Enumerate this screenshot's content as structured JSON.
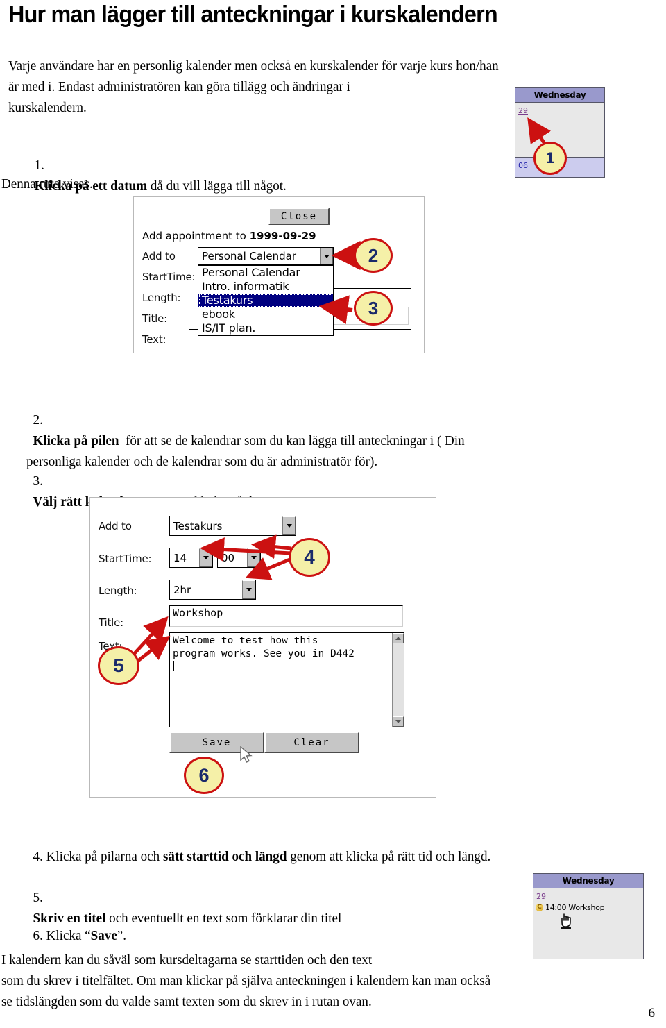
{
  "document": {
    "title": "Hur man lägger till anteckningar i kurskalendern",
    "page_number": "6"
  },
  "paragraphs": {
    "intro": "Varje användare har en personlig kalender men också en kurskalender för varje kurs hon/han\när med i. Endast administratören kan göra tillägg och ändringar i\nkurskalendern.",
    "step1_num": "1.",
    "step1_bold": "Klicka på ett datum",
    "step1_rest": " då du vill lägga till något.",
    "caption_dialog": "Denna ruta visas.",
    "step2_num": "2.",
    "step2_bold": "Klicka på pilen",
    "step2_rest": "  för att se de kalendrar som du kan lägga till anteckningar i ( Din\npersonliga kalender och de kalendrar som du är administratör för).",
    "step3_num": "3.",
    "step3_bold": "Välj rätt kalender",
    "step3_rest": " genom att klicka på den.",
    "step4_num": "4.",
    "step4_pre": " Klicka på pilarna och ",
    "step4_bold": "sätt starttid och längd",
    "step4_rest": " genom att klicka på rätt tid och längd.",
    "step5_num": "5.",
    "step5_bold": "Skriv en titel",
    "step5_rest": " och eventuellt en text som förklarar din titel",
    "step6_num": "6.",
    "step6_pre": " Klicka “",
    "step6_bold": "Save",
    "step6_rest": "”.",
    "outro": "I kalendern kan du såväl som kursdeltagarna se starttiden och den text\nsom du skrev i titelfältet. Om man klickar på själva anteckningen i kalendern kan man också\nse tidslängden som du valde samt texten som du skrev in i rutan ovan."
  },
  "calendar_top": {
    "day_header": "Wednesday",
    "date_link": "29",
    "next_date_link": "06",
    "callout": "1"
  },
  "calendar_bottom": {
    "day_header": "Wednesday",
    "date_link": "29",
    "event_bullet": "C",
    "event_label": "14:00 Workshop"
  },
  "dialog_dropdown": {
    "close_button": "Close",
    "heading_prefix": "Add appointment to ",
    "heading_date": "1999-09-29",
    "labels": {
      "add_to": "Add to",
      "start_time": "StartTime:",
      "length": "Length:",
      "title": "Title:",
      "text": "Text:"
    },
    "selected_value": "Personal Calendar",
    "options": [
      "Personal Calendar",
      "Intro. informatik",
      "Testakurs",
      "ebook",
      "IS/IT plan."
    ],
    "selected_index": 2,
    "callouts": {
      "arrow": "2",
      "option": "3"
    }
  },
  "dialog_filled": {
    "labels": {
      "add_to": "Add to",
      "start_time": "StartTime:",
      "length": "Length:",
      "title": "Title:",
      "text": "Text:"
    },
    "add_to_value": "Testakurs",
    "start_hour": "14",
    "start_minute": "00",
    "length_value": "2hr",
    "title_value": "Workshop",
    "text_value": "Welcome to test how this\nprogram works. See you in D442",
    "save_button": "Save",
    "clear_button": "Clear",
    "callouts": {
      "time": "4",
      "text": "5",
      "save": "6"
    }
  },
  "colors": {
    "callout_fill": "#f5f0a8",
    "callout_border": "#cc1111",
    "callout_text": "#1a2a6b",
    "arrow_red": "#cc1111",
    "calendar_header": "#9999cc",
    "calendar_body": "#e8e8e8",
    "calendar_alt_row": "#ccccee",
    "listbox_selected": "#000080",
    "button_face": "#c6c6c6"
  }
}
